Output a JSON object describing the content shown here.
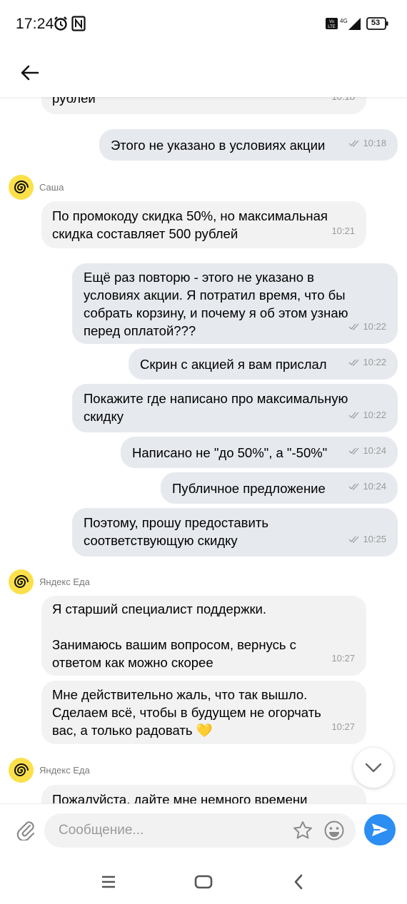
{
  "status_bar": {
    "time": "17:24",
    "battery": "53"
  },
  "chat": {
    "messages": [
      {
        "text": "рублей",
        "time": "10:18",
        "read": false
      },
      {
        "text": "Этого не указано в условиях акции",
        "time": "10:18",
        "read": true
      },
      {
        "sender": "Саша"
      },
      {
        "text": "По промокоду скидка 50%, но максимальная\nскидка составляет 500 рублей",
        "time": "10:21",
        "read": false
      },
      {
        "text": "Ещё раз повторю - этого не указано в\nусловиях акции. Я потратил время, что бы\nсобрать корзину, и почему я об этом узнаю\nперед оплатой???",
        "time": "10:22",
        "read": true
      },
      {
        "text": "Скрин с акцией я вам прислал",
        "time": "10:22",
        "read": true
      },
      {
        "text": "Покажите где написано про максимальную\nскидку",
        "time": "10:22",
        "read": true
      },
      {
        "text": "Написано не \"до 50%\", а \"-50%\"",
        "time": "10:24",
        "read": true
      },
      {
        "text": "Публичное предложение",
        "time": "10:24",
        "read": true
      },
      {
        "text": "Поэтому, прошу предоставить\nсоответствующую скидку",
        "time": "10:25",
        "read": true
      },
      {
        "sender": "Яндекс Еда"
      },
      {
        "text": "Я старший специалист поддержки.\n\nЗанимаюсь вашим вопросом, вернусь с\nответом как можно скорее",
        "time": "10:27",
        "read": false
      },
      {
        "text": "Мне действительно жаль, что так вышло.\nСделаем всё, чтобы в будущем не огорчать\nвас, а только радовать 💛",
        "time": "10:27",
        "read": false
      },
      {
        "sender": "Яндекс Еда"
      },
      {
        "text": "Пожалуйста, дайте мне немного времени",
        "time": "",
        "read": false
      }
    ]
  },
  "input": {
    "placeholder": "Сообщение..."
  },
  "colors": {
    "outgoing_bubble": "#e6e9ee",
    "incoming_bubble": "#f2f2f2",
    "avatar": "#fbe04a",
    "send_button": "#2c8df3"
  },
  "icons": [
    "alarm-icon",
    "nfc-icon",
    "volte-icon",
    "signal-icon",
    "battery-icon",
    "back-arrow-icon",
    "avatar-spiral-icon",
    "double-check-icon",
    "chevron-down-icon",
    "paperclip-icon",
    "star-icon",
    "emoji-icon",
    "send-icon",
    "nav-menu-icon",
    "nav-home-icon",
    "nav-back-icon"
  ]
}
